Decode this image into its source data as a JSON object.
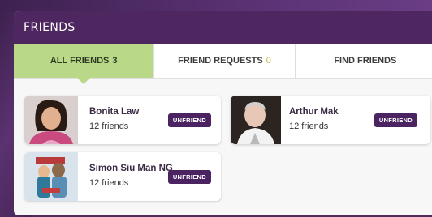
{
  "panel": {
    "title": "FRIENDS"
  },
  "tabs": [
    {
      "label": "ALL FRIENDS",
      "count": "3",
      "active": true
    },
    {
      "label": "FRIEND REQUESTS",
      "count": "0",
      "active": false
    },
    {
      "label": "FIND FRIENDS",
      "count": "",
      "active": false
    }
  ],
  "friends": [
    {
      "name": "Bonita Law",
      "subtitle": "12 friends",
      "action": "UNFRIEND",
      "avatar": "photo of woman"
    },
    {
      "name": "Arthur Mak",
      "subtitle": "12 friends",
      "action": "UNFRIEND",
      "avatar": "photo of man"
    },
    {
      "name": "Simon Siu Man NG",
      "subtitle": "12 friends",
      "action": "UNFRIEND",
      "avatar": "photo of figures"
    }
  ],
  "colors": {
    "header_bg": "#4f2760",
    "active_tab_bg": "#b9d989",
    "button_bg": "#4a2360",
    "page_bg": "#4f2a5c"
  }
}
